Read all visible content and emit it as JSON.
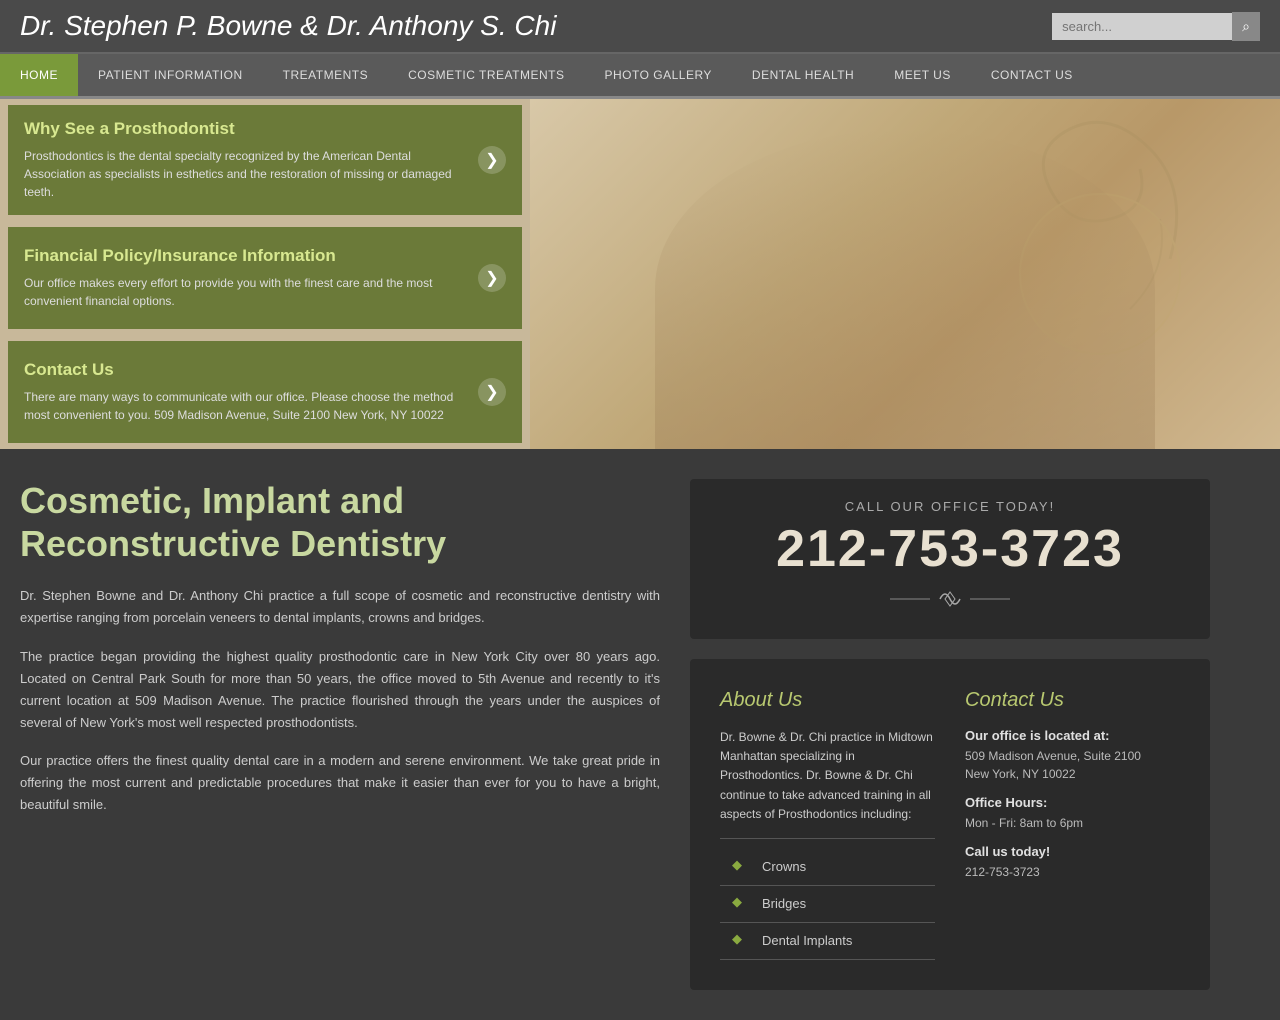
{
  "header": {
    "title": "Dr. Stephen P. Bowne & Dr. Anthony S. Chi",
    "search_placeholder": "search..."
  },
  "nav": {
    "items": [
      {
        "label": "HOME",
        "active": true
      },
      {
        "label": "PATIENT INFORMATION",
        "active": false
      },
      {
        "label": "TREATMENTS",
        "active": false
      },
      {
        "label": "COSMETIC TREATMENTS",
        "active": false
      },
      {
        "label": "PHOTO GALLERY",
        "active": false
      },
      {
        "label": "DENTAL HEALTH",
        "active": false
      },
      {
        "label": "MEET US",
        "active": false
      },
      {
        "label": "CONTACT US",
        "active": false
      }
    ]
  },
  "hero": {
    "cards": [
      {
        "title": "Why See a Prosthodontist",
        "text": "Prosthodontics is the dental specialty recognized by the American Dental Association as specialists in esthetics and the restoration of missing or damaged teeth."
      },
      {
        "title": "Financial Policy/Insurance Information",
        "text": "Our office makes every effort to provide you with the finest care and the most convenient financial options."
      },
      {
        "title": "Contact Us",
        "text": "There are many ways to communicate with our office. Please choose the method most convenient to you. 509 Madison Avenue, Suite 2100 New York, NY 10022"
      }
    ]
  },
  "main": {
    "heading": "Cosmetic, Implant and\nReconstructive Dentistry",
    "paragraphs": [
      "Dr. Stephen Bowne and Dr. Anthony Chi practice a full scope of cosmetic and reconstructive dentistry with expertise ranging from porcelain veneers to dental implants, crowns and bridges.",
      "The practice began providing the highest quality prosthodontic care in New York City over 80 years ago. Located on Central Park South for more than 50 years, the office moved to 5th Avenue and recently to it's current location at 509 Madison Avenue. The practice flourished through the years under the auspices of several of New York's most well respected prosthodontists.",
      "Our practice offers the finest quality dental care in a modern and serene environment. We take great pride in offering the most current and predictable procedures that make it easier than ever for you to have a bright, beautiful smile."
    ]
  },
  "call": {
    "label": "CALL OUR OFFICE TODAY!",
    "number": "212-753-3723"
  },
  "about": {
    "title": "About Us",
    "text": "Dr. Bowne & Dr. Chi practice in Midtown Manhattan specializing in Prosthodontics. Dr. Bowne & Dr. Chi continue to take advanced training in all aspects of Prosthodontics including:",
    "list": [
      "Crowns",
      "Bridges",
      "Dental Implants"
    ]
  },
  "contact_box": {
    "title": "Contact Us",
    "office_label": "Our office is located at:",
    "address": "509 Madison Avenue, Suite 2100\nNew York, NY 10022",
    "hours_label": "Office Hours:",
    "hours": "Mon - Fri: 8am to 6pm",
    "call_label": "Call us today!",
    "phone": "212-753-3723"
  }
}
